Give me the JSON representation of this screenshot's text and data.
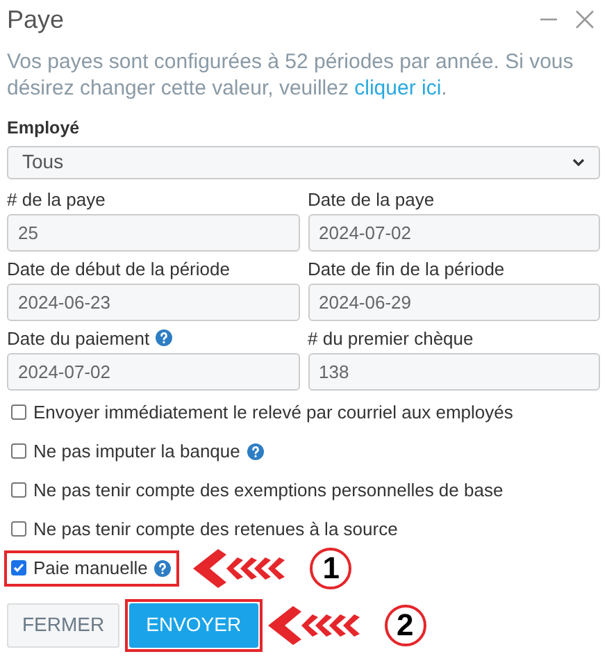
{
  "window": {
    "title": "Paye"
  },
  "intro": {
    "text": "Vos payes sont configurées à 52 périodes par année. Si vous désirez changer cette valeur, veuillez ",
    "link": "cliquer ici",
    "after": "."
  },
  "employee": {
    "label": "Employé",
    "value": "Tous"
  },
  "fields": [
    {
      "label": "# de la paye",
      "value": "25",
      "help": false
    },
    {
      "label": "Date de la paye",
      "value": "2024-07-02",
      "help": false
    },
    {
      "label": "Date de début de la période",
      "value": "2024-06-23",
      "help": false
    },
    {
      "label": "Date de fin de la période",
      "value": "2024-06-29",
      "help": false
    },
    {
      "label": "Date du paiement",
      "value": "2024-07-02",
      "help": true
    },
    {
      "label": "# du premier chèque",
      "value": "138",
      "help": false
    }
  ],
  "options": [
    {
      "label": "Envoyer immédiatement le relevé par courriel aux employés",
      "checked": false,
      "help": false
    },
    {
      "label": "Ne pas imputer la banque",
      "checked": false,
      "help": true
    },
    {
      "label": "Ne pas tenir compte des exemptions personnelles de base",
      "checked": false,
      "help": false
    },
    {
      "label": "Ne pas tenir compte des retenues à la source",
      "checked": false,
      "help": false
    },
    {
      "label": "Paie manuelle",
      "checked": true,
      "help": true,
      "callout": "1"
    }
  ],
  "buttons": [
    {
      "label": "FERMER",
      "kind": "secondary"
    },
    {
      "label": "ENVOYER",
      "kind": "primary",
      "callout": "2"
    }
  ]
}
